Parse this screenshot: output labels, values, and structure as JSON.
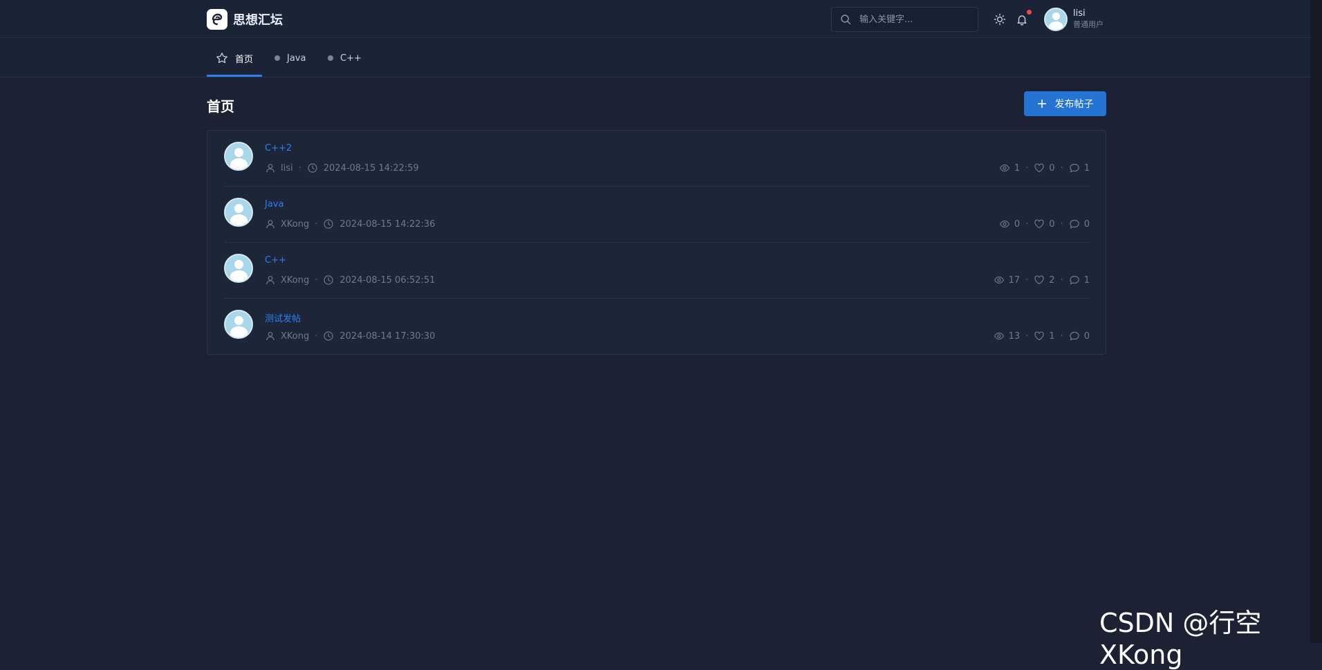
{
  "app": {
    "name": "思想汇坛"
  },
  "search": {
    "placeholder": "输入关键字..."
  },
  "user": {
    "name": "lisi",
    "role": "普通用户"
  },
  "nav": {
    "items": [
      {
        "label": "首页",
        "icon": "star-icon",
        "active": true
      },
      {
        "label": "Java",
        "icon": "dot-icon",
        "active": false
      },
      {
        "label": "C++",
        "icon": "dot-icon",
        "active": false
      }
    ]
  },
  "page": {
    "title": "首页",
    "publish_label": "发布帖子"
  },
  "posts": [
    {
      "title": "C++2",
      "author": "lisi",
      "time": "2024-08-15 14:22:59",
      "views": "1",
      "likes": "0",
      "comments": "1"
    },
    {
      "title": "Java",
      "author": "XKong",
      "time": "2024-08-15 14:22:36",
      "views": "0",
      "likes": "0",
      "comments": "0"
    },
    {
      "title": "C++",
      "author": "XKong",
      "time": "2024-08-15 06:52:51",
      "views": "17",
      "likes": "2",
      "comments": "1"
    },
    {
      "title": "测试发帖",
      "author": "XKong",
      "time": "2024-08-14 17:30:30",
      "views": "13",
      "likes": "1",
      "comments": "0"
    }
  ],
  "watermark": "CSDN @行空XKong",
  "colors": {
    "accent": "#2f7ff0",
    "button": "#2574d3",
    "background": "#1c2233",
    "notify": "#f04848"
  }
}
